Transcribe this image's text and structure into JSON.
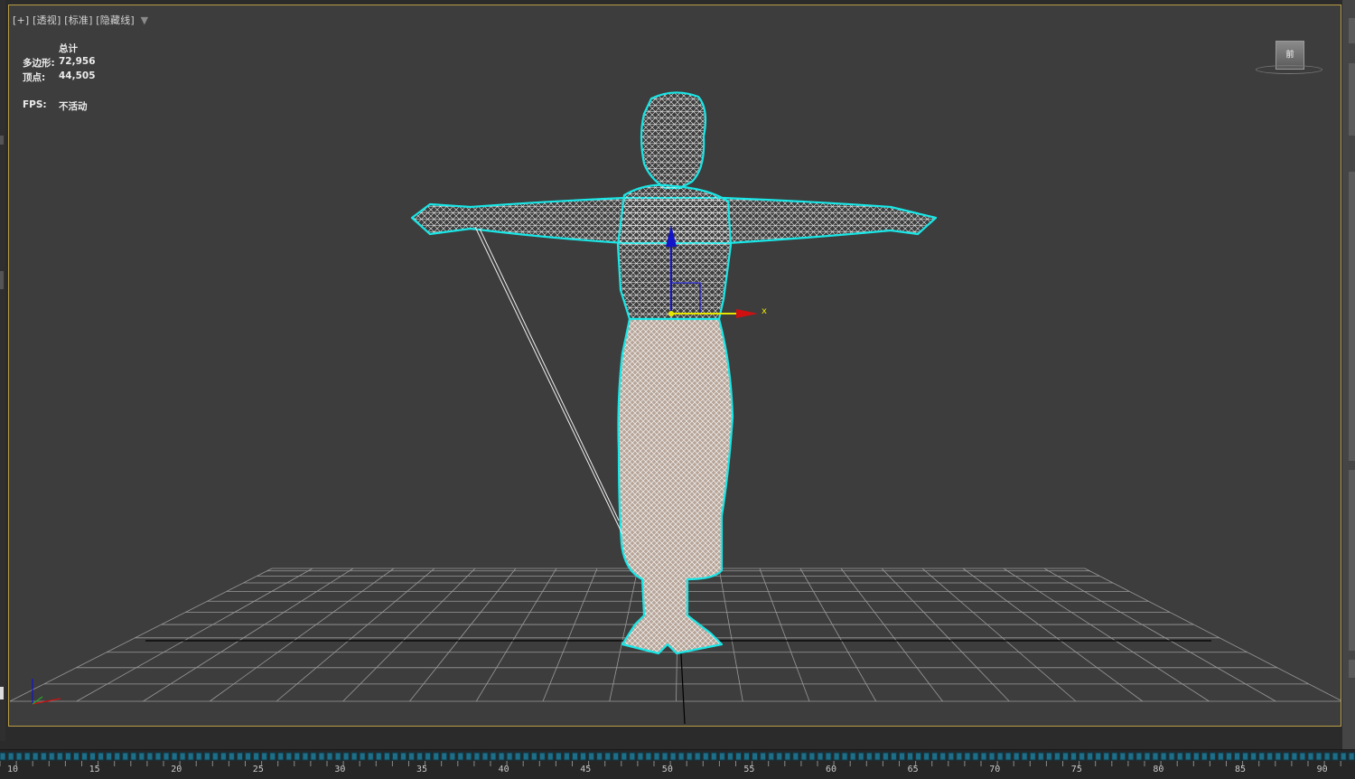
{
  "viewport": {
    "label_plus": "[+]",
    "label_view": "[透视]",
    "label_shading": "[标准]",
    "label_mode": "[隐藏线]",
    "filter_icon": "filter-funnel-icon"
  },
  "stats": {
    "header": "总计",
    "polygons_label": "多边形:",
    "polygons_value": "72,956",
    "vertices_label": "顶点:",
    "vertices_value": "44,505",
    "fps_label": "FPS:",
    "fps_value": "不活动"
  },
  "viewcube": {
    "face_label": "前"
  },
  "gizmo": {
    "x_label": "x"
  },
  "timeline": {
    "labels": [
      "10",
      "15",
      "20",
      "25",
      "30",
      "35",
      "40",
      "45",
      "50",
      "55",
      "60",
      "65",
      "70",
      "75",
      "80",
      "85",
      "90"
    ]
  },
  "colors": {
    "viewport_border": "#b79d45",
    "selection_outline": "#19e6e6",
    "wire": "#ffffff",
    "axis_x": "#d01010",
    "axis_y": "#e6e600",
    "axis_z": "#1414c8"
  }
}
